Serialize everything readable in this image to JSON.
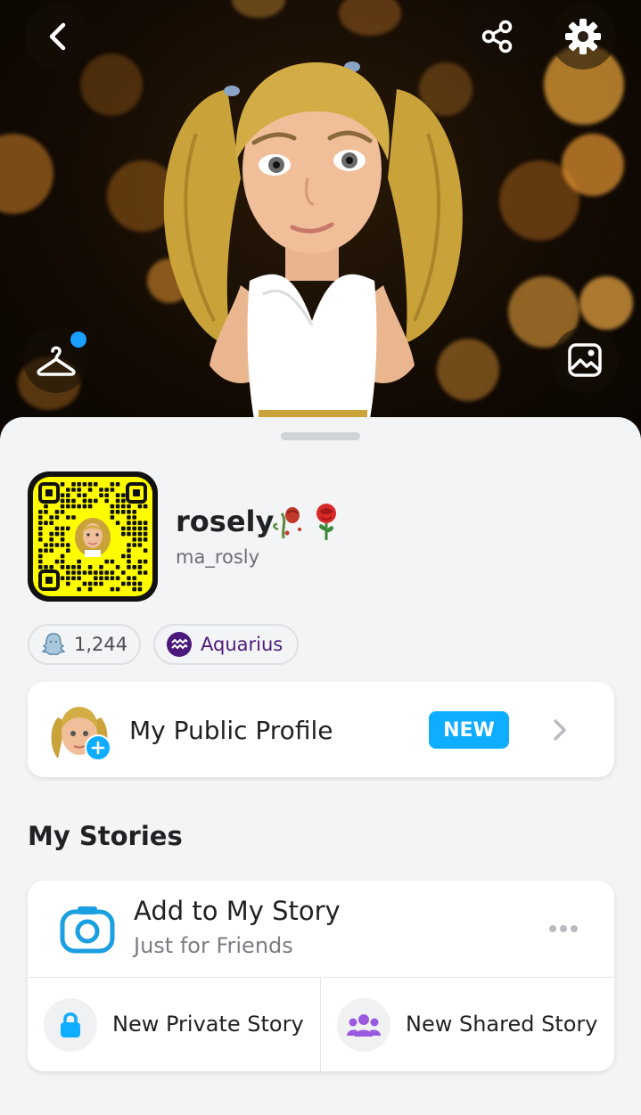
{
  "header": {
    "back_icon": "chevron-left-icon",
    "share_icon": "share-icon",
    "settings_icon": "gear-icon",
    "outfit_icon": "hanger-icon",
    "background_icon": "image-icon"
  },
  "profile": {
    "display_name": "rosely",
    "username": "ma_rosly"
  },
  "chips": {
    "snapscore": "1,244",
    "zodiac": "Aquarius"
  },
  "public_profile": {
    "title": "My Public Profile",
    "badge": "NEW"
  },
  "stories": {
    "section_title": "My Stories",
    "add_title": "Add to My Story",
    "add_subtitle": "Just for Friends",
    "private_label": "New Private Story",
    "shared_label": "New Shared Story"
  },
  "colors": {
    "accent_blue": "#0fadff",
    "snapcode_yellow": "#fffc00",
    "zodiac_purple": "#4b1a7a",
    "shared_purple": "#9b59e0"
  }
}
